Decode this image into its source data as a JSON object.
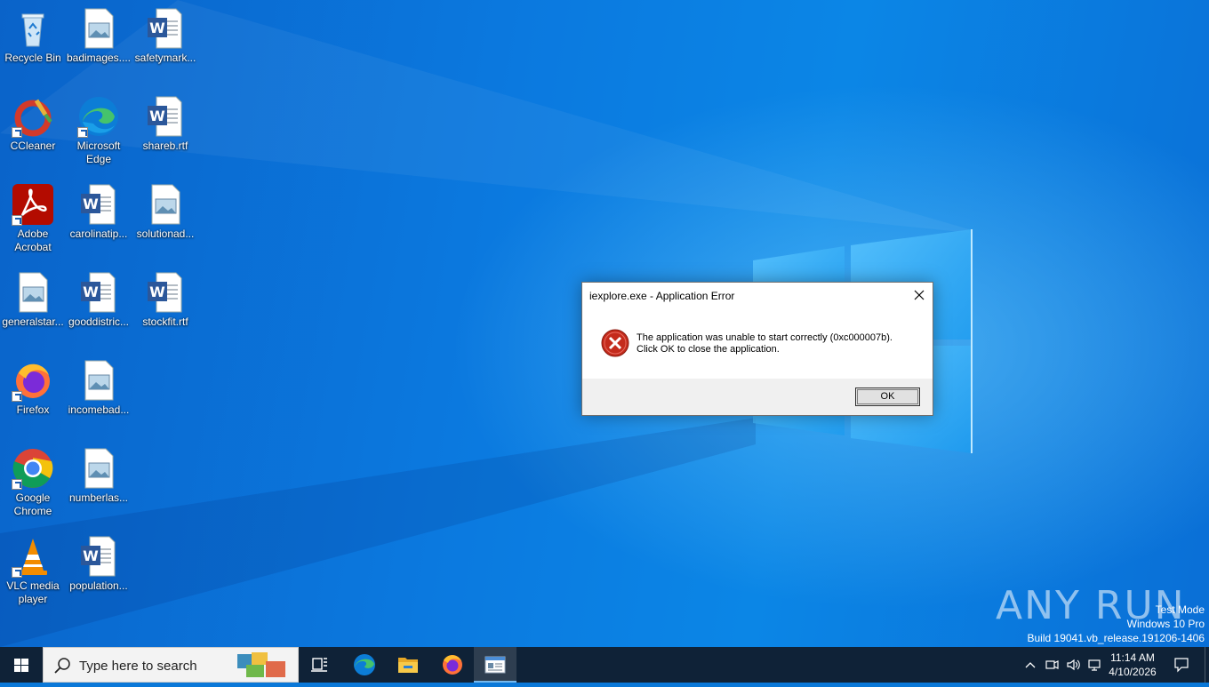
{
  "desktop": {
    "icons": [
      {
        "label": "Recycle Bin",
        "icon": "recycle-bin-icon"
      },
      {
        "label": "badimages....",
        "icon": "image-file-icon"
      },
      {
        "label": "safetymark...",
        "icon": "word-doc-icon"
      },
      {
        "label": "CCleaner",
        "icon": "ccleaner-icon"
      },
      {
        "label": "Microsoft Edge",
        "icon": "edge-icon"
      },
      {
        "label": "shareb.rtf",
        "icon": "word-doc-icon"
      },
      {
        "label": "Adobe Acrobat",
        "icon": "acrobat-icon"
      },
      {
        "label": "carolinatip...",
        "icon": "word-doc-icon"
      },
      {
        "label": "solutionad...",
        "icon": "image-file-icon"
      },
      {
        "label": "generalstar...",
        "icon": "image-file-icon"
      },
      {
        "label": "gooddistric...",
        "icon": "word-doc-icon"
      },
      {
        "label": "stockfit.rtf",
        "icon": "word-doc-icon"
      },
      {
        "label": "Firefox",
        "icon": "firefox-icon"
      },
      {
        "label": "incomebad...",
        "icon": "image-file-icon"
      },
      {
        "label": "Google Chrome",
        "icon": "chrome-icon"
      },
      {
        "label": "numberlas...",
        "icon": "image-file-icon"
      },
      {
        "label": "VLC media player",
        "icon": "vlc-icon"
      },
      {
        "label": "population...",
        "icon": "word-doc-icon"
      }
    ]
  },
  "dialog": {
    "title": "iexplore.exe - Application Error",
    "message_line1": "The application was unable to start correctly (0xc000007b).",
    "message_line2": "Click OK to close the application.",
    "ok_label": "OK",
    "icon": "error-icon"
  },
  "watermark": {
    "brand": "ANY RUN",
    "line1": "Test Mode",
    "line2": "Windows 10 Pro",
    "line3": "Build 19041.vb_release.191206-1406"
  },
  "taskbar": {
    "search_placeholder": "Type here to search",
    "time": "11:14 AM",
    "date": "4/10/2026",
    "pinned": [
      "task-view-icon",
      "edge-icon",
      "file-explorer-icon",
      "firefox-icon",
      "error-app-icon"
    ]
  },
  "colors": {
    "desktop_blue": "#0a78d8",
    "taskbar": "#0f2237",
    "error_red": "#c42b1c"
  }
}
